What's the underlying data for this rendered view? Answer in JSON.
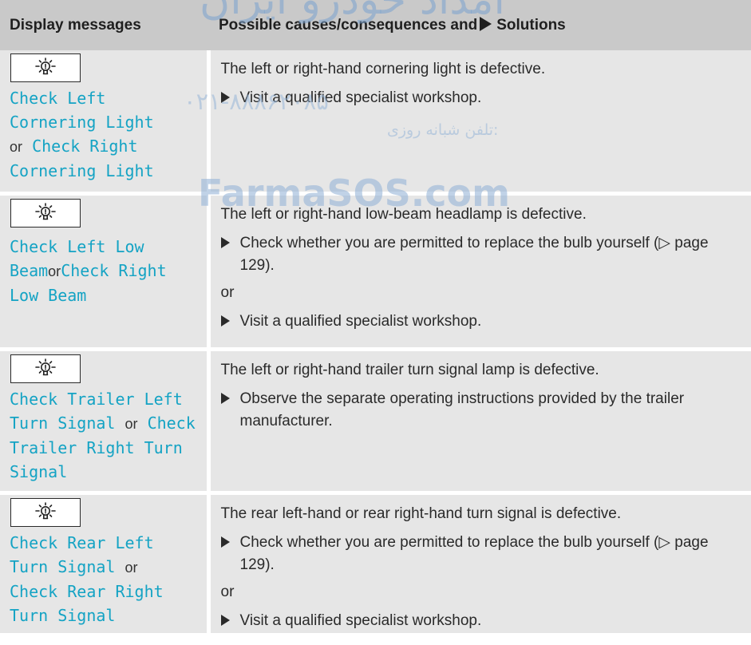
{
  "watermarks": {
    "top": "ﺍمداد خودرو ایران",
    "phone": "۰۲۱-۸۸۸۶۲۰۸۵",
    "phone_label": "تلفن شبانه روزی:",
    "site": "FarmaSOS.com"
  },
  "headers": {
    "display_messages": "Display messages",
    "causes_prefix": "Possible causes/consequences and",
    "solutions": "Solutions"
  },
  "icon": "light-bulb-warning-icon",
  "rows": [
    {
      "msg1": "Check Left Cornering Light",
      "connector": "or",
      "msg2": "Check Right Cornering Light",
      "cause": "The left or right-hand cornering light is defective.",
      "step1": "Visit a qualified specialist workshop."
    },
    {
      "msg1": "Check Left Low Beam",
      "connector": "or",
      "msg2": "Check Right Low Beam",
      "cause": "The left or right-hand low-beam headlamp is defective.",
      "step1": "Check whether you are permitted to replace the bulb yourself (▷ page 129).",
      "or": "or",
      "step2": "Visit a qualified specialist workshop."
    },
    {
      "msg1": "Check Trailer Left Turn Signal",
      "connector": "or",
      "msg2": "Check Trailer Right Turn Signal",
      "cause": "The left or right-hand trailer turn signal lamp is defective.",
      "step1": "Observe the separate operating instructions provided by the trailer manufacturer."
    },
    {
      "msg1": "Check Rear Left Turn Signal",
      "connector": "or",
      "msg2": "Check Rear Right Turn Signal",
      "cause": "The rear left-hand or rear right-hand turn signal is defective.",
      "step1": "Check whether you are permitted to replace the bulb yourself (▷ page 129).",
      "or": "or",
      "step2": "Visit a qualified specialist workshop."
    }
  ]
}
